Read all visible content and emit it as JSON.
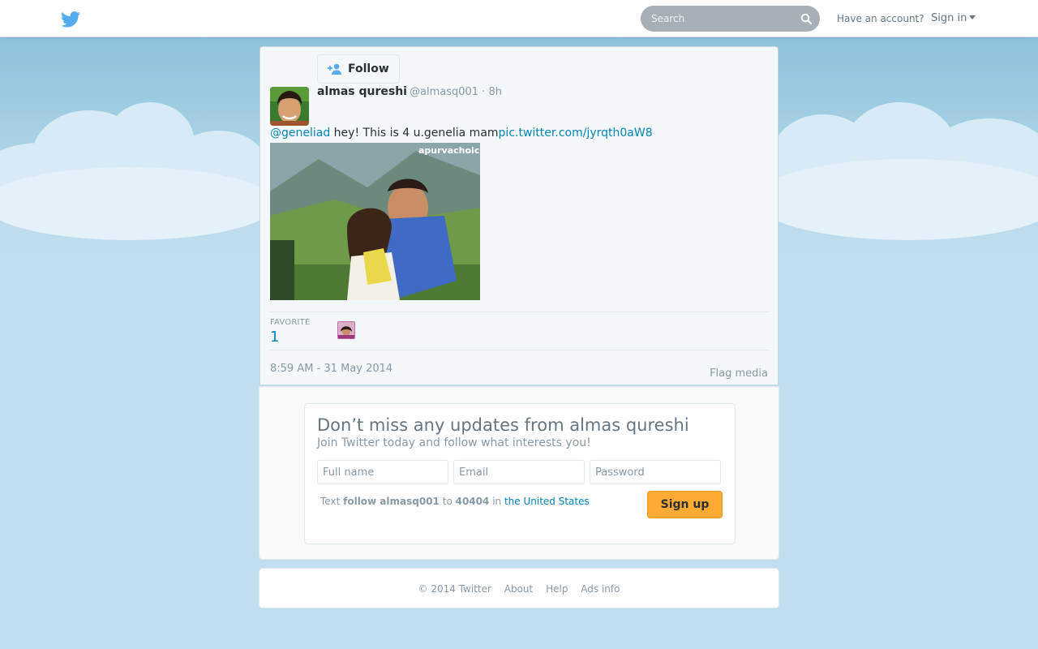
{
  "header": {
    "search_placeholder": "Search",
    "have_account": "Have an account?",
    "sign_in": "Sign in"
  },
  "tweet": {
    "follow_label": "Follow",
    "fullname": "almas qureshi",
    "handle_time": "@almasq001 · 8h",
    "mention": "@geneliad",
    "text": " hey! This is 4 u.genelia mam",
    "pic_link": "pic.twitter.com/jyrqth0aW8",
    "photo_overlay_text": "apurvachoice",
    "favorite_label": "FAVORITE",
    "favorite_count": "1",
    "timestamp": "8:59 AM - 31 May 2014",
    "flag_media": "Flag media"
  },
  "signup": {
    "title": "Don’t miss any updates from almas qureshi",
    "subtitle": "Join Twitter today and follow what interests you!",
    "fullname_placeholder": "Full name",
    "email_placeholder": "Email",
    "password_placeholder": "Password",
    "sms_text": "Text",
    "sms_command": "follow almasq001",
    "sms_to": "to",
    "sms_number": "40404",
    "sms_in": "in",
    "sms_country": "the United States",
    "button": "Sign up"
  },
  "footer": {
    "copyright": "© 2014 Twitter",
    "about": "About",
    "help": "Help",
    "ads_info": "Ads info"
  },
  "colors": {
    "link": "#0084b4",
    "brand": "#55acee",
    "signup_button": "#ffaa33"
  }
}
